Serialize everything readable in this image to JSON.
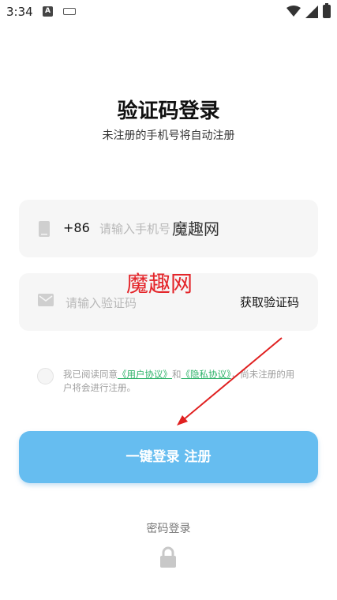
{
  "status_bar": {
    "time": "3:34",
    "a_badge": "A"
  },
  "header": {
    "title": "验证码登录",
    "subtitle": "未注册的手机号将自动注册"
  },
  "phone_field": {
    "prefix": "+86",
    "placeholder": "请输入手机号"
  },
  "code_field": {
    "placeholder": "请输入验证码",
    "get_code_label": "获取验证码"
  },
  "watermarks": [
    "魔趣网",
    "魔趣网"
  ],
  "agreement": {
    "prefix": "我已阅读同意",
    "user_link": "《用户协议》",
    "and": "和",
    "privacy_link": "《隐私协议》",
    "suffix": "，尚未注册的用户将会进行注册。"
  },
  "login_button": {
    "label": "一键登录 注册"
  },
  "password_login": {
    "label": "密码登录"
  },
  "colors": {
    "accent": "#66bdf0",
    "link": "#2fb36a",
    "watermark_red": "#e4262b",
    "field_bg": "#f6f6f6"
  },
  "icons": [
    "phone-icon",
    "mail-icon",
    "lock-icon",
    "wifi-icon",
    "signal-icon",
    "battery-icon",
    "keyboard-icon"
  ]
}
